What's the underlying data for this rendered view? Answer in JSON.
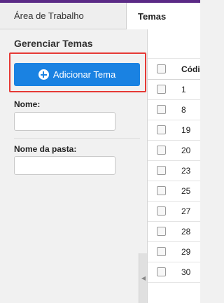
{
  "tabs": [
    {
      "label": "Área de Trabalho"
    },
    {
      "label": "Temas"
    }
  ],
  "panel": {
    "title": "Gerenciar Temas",
    "add_button_label": "Adicionar Tema",
    "fields": [
      {
        "label": "Nome:",
        "value": "",
        "placeholder": ""
      },
      {
        "label": "Nome da pasta:",
        "value": "",
        "placeholder": ""
      }
    ]
  },
  "table": {
    "header": "Códig",
    "rows": [
      "1",
      "8",
      "19",
      "20",
      "23",
      "25",
      "27",
      "28",
      "29",
      "30"
    ]
  },
  "icons": {
    "add": "plus-circle-icon",
    "collapse": "chevron-left-icon"
  },
  "colors": {
    "accent": "#1a82e2",
    "highlight": "#e53935",
    "topline": "#5b2a86"
  }
}
